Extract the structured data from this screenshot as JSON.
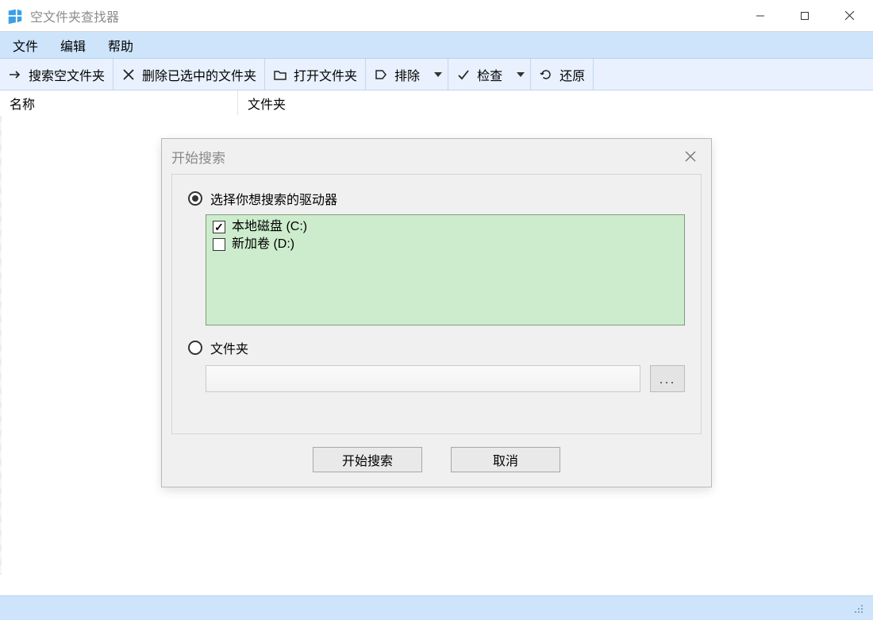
{
  "window": {
    "title": "空文件夹查找器"
  },
  "menubar": {
    "file": "文件",
    "edit": "编辑",
    "help": "帮助"
  },
  "toolbar": {
    "search": "搜索空文件夹",
    "delete": "删除已选中的文件夹",
    "open": "打开文件夹",
    "exclude": "排除",
    "check": "检查",
    "restore": "还原"
  },
  "columns": {
    "name": "名称",
    "folder": "文件夹"
  },
  "dialog": {
    "title": "开始搜索",
    "option_drives_label": "选择你想搜索的驱动器",
    "drives": [
      {
        "label": "本地磁盘 (C:)",
        "checked": true
      },
      {
        "label": "新加卷 (D:)",
        "checked": false
      }
    ],
    "option_folder_label": "文件夹",
    "folder_path": "",
    "browse_label": "...",
    "start_button": "开始搜索",
    "cancel_button": "取消"
  }
}
